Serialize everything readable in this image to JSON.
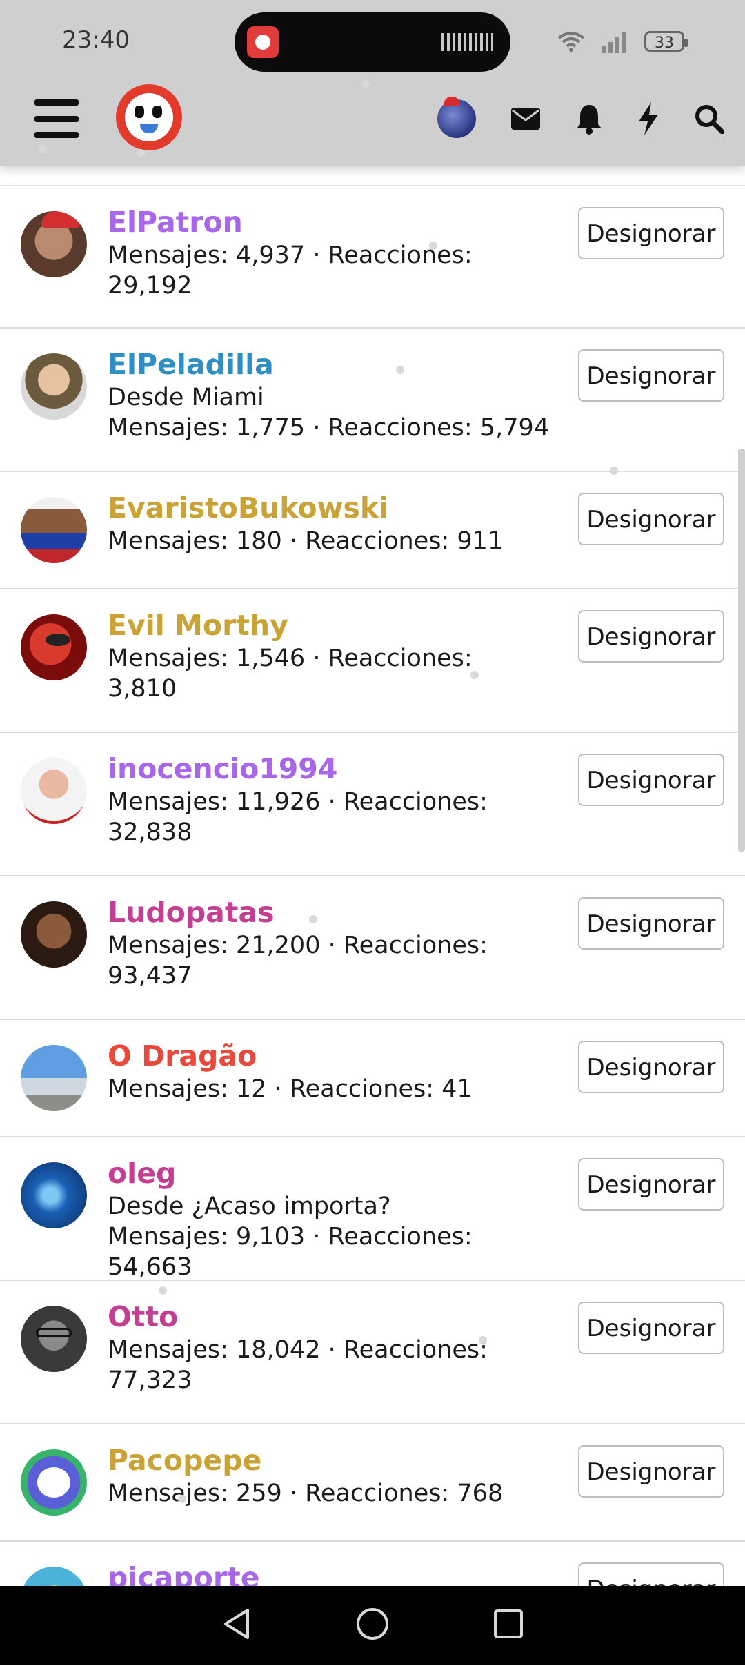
{
  "status_bar": {
    "time": "23:40",
    "battery": "33"
  },
  "header": {
    "icons": [
      "menu-icon",
      "site-logo",
      "user-avatar",
      "envelope-icon",
      "bell-icon",
      "bolt-icon",
      "search-icon"
    ]
  },
  "list": {
    "button_label": "Designorar",
    "members": [
      {
        "name": "ElPatron",
        "color": "#a866e8",
        "lines": [
          "Mensajes: 4,937 · Reacciones:",
          "29,192"
        ]
      },
      {
        "name": "ElPeladilla",
        "color": "#2f8fc4",
        "lines": [
          "Desde Miami",
          "Mensajes: 1,775 · Reacciones: 5,794"
        ]
      },
      {
        "name": "EvaristoBukowski",
        "color": "#c9a336",
        "lines": [
          "Mensajes: 180 · Reacciones: 911"
        ]
      },
      {
        "name": "Evil Morthy",
        "color": "#c9a336",
        "lines": [
          "Mensajes: 1,546 · Reacciones:",
          "3,810"
        ]
      },
      {
        "name": "inocencio1994",
        "color": "#a866e8",
        "lines": [
          "Mensajes: 11,926 · Reacciones:",
          "32,838"
        ]
      },
      {
        "name": "Ludopatas",
        "color": "#c23f92",
        "lines": [
          "Mensajes: 21,200 · Reacciones:",
          "93,437"
        ]
      },
      {
        "name": "O Dragão",
        "color": "#e8493a",
        "lines": [
          "Mensajes: 12 · Reacciones: 41"
        ]
      },
      {
        "name": "oleg",
        "color": "#c23f92",
        "lines": [
          "Desde ¿Acaso importa?",
          "Mensajes: 9,103 · Reacciones: 54,663"
        ]
      },
      {
        "name": "Otto",
        "color": "#c23f92",
        "lines": [
          "Mensajes: 18,042 · Reacciones:",
          "77,323"
        ]
      },
      {
        "name": "Pacopepe",
        "color": "#c9a336",
        "lines": [
          "Mensajes: 259 · Reacciones: 768"
        ]
      },
      {
        "name": "picaporte",
        "color": "#a866e8",
        "lines": []
      }
    ]
  }
}
